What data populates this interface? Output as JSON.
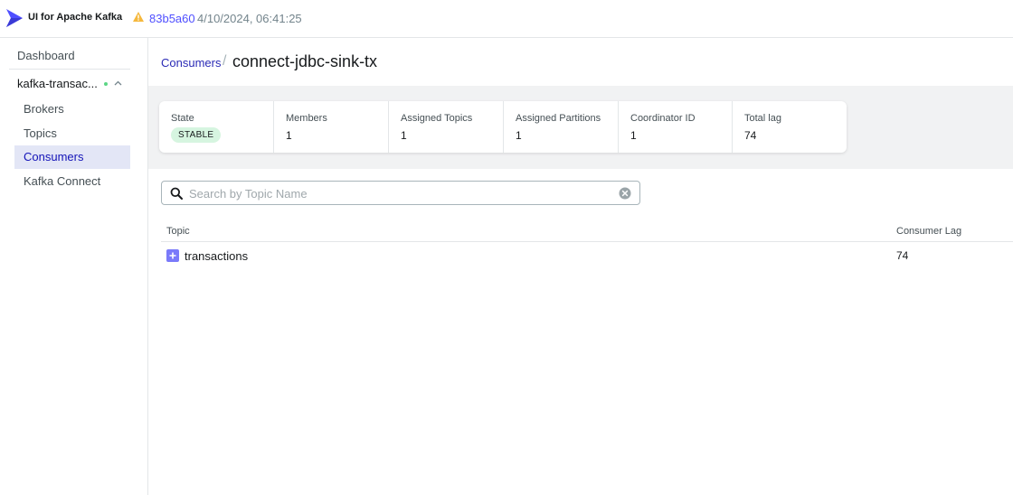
{
  "app": {
    "brand": "UI for Apache Kafka",
    "version_commit": "83b5a60",
    "version_date": "4/10/2024, 06:41:25",
    "accent_color": "#4f4fff"
  },
  "sidebar": {
    "dashboard_label": "Dashboard",
    "cluster_label": "kafka-transac...",
    "cluster_status_color": "#5cd685",
    "items": [
      {
        "label": "Brokers",
        "active": false
      },
      {
        "label": "Topics",
        "active": false
      },
      {
        "label": "Consumers",
        "active": true
      },
      {
        "label": "Kafka Connect",
        "active": false
      }
    ]
  },
  "breadcrumb": {
    "parent": "Consumers",
    "separator": "/",
    "current": "connect-jdbc-sink-tx"
  },
  "stats": [
    {
      "label": "State",
      "value": "STABLE",
      "is_badge": true
    },
    {
      "label": "Members",
      "value": "1"
    },
    {
      "label": "Assigned Topics",
      "value": "1"
    },
    {
      "label": "Assigned Partitions",
      "value": "1"
    },
    {
      "label": "Coordinator ID",
      "value": "1"
    },
    {
      "label": "Total lag",
      "value": "74"
    }
  ],
  "search": {
    "placeholder": "Search by Topic Name",
    "value": ""
  },
  "table": {
    "columns": [
      "Topic",
      "Consumer Lag"
    ],
    "rows": [
      {
        "topic": "transactions",
        "consumer_lag": "74"
      }
    ]
  }
}
